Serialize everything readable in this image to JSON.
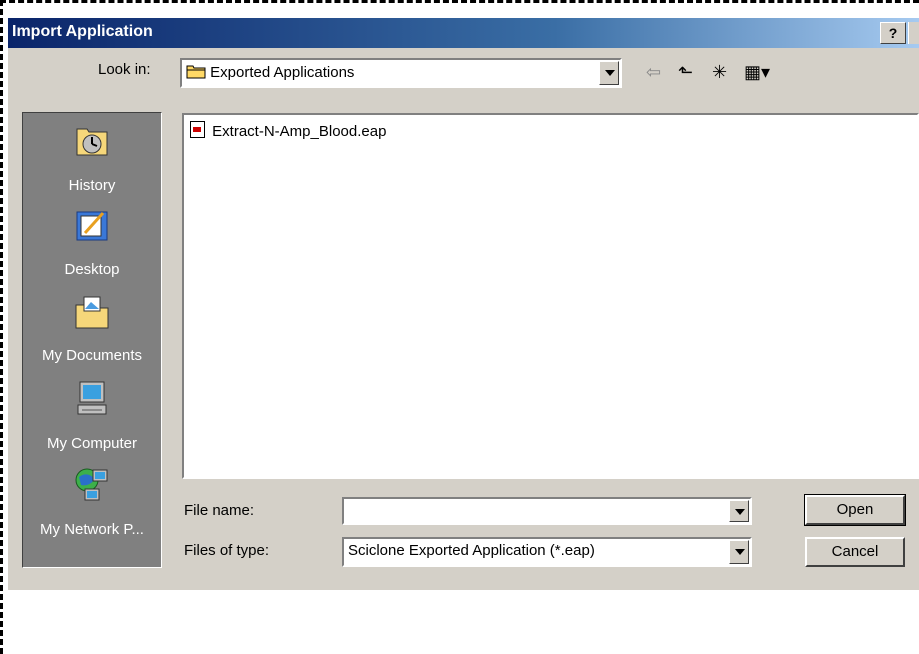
{
  "dialog": {
    "title": "Import Application",
    "help_label": "?"
  },
  "lookin": {
    "label": "Look in:",
    "value": "Exported Applications"
  },
  "toolbar": {
    "back_glyph": "⇦",
    "up_glyph": "⬑",
    "newfolder_glyph": "✳",
    "view_glyph": "▦▾"
  },
  "places": [
    {
      "label": "History",
      "icon": "history-icon"
    },
    {
      "label": "Desktop",
      "icon": "desktop-icon"
    },
    {
      "label": "My Documents",
      "icon": "my-documents-icon"
    },
    {
      "label": "My Computer",
      "icon": "my-computer-icon"
    },
    {
      "label": "My Network P...",
      "icon": "my-network-places-icon"
    }
  ],
  "files": [
    {
      "name": "Extract-N-Amp_Blood.eap"
    }
  ],
  "filename": {
    "label": "File name:",
    "value": ""
  },
  "filetype": {
    "label": "Files of type:",
    "value": "Sciclone Exported Application (*.eap)"
  },
  "buttons": {
    "open": "Open",
    "cancel": "Cancel"
  },
  "colors": {
    "title_start": "#0a246a",
    "title_end": "#a6caf0",
    "face": "#d4d0c8",
    "places_bg": "#808080"
  }
}
